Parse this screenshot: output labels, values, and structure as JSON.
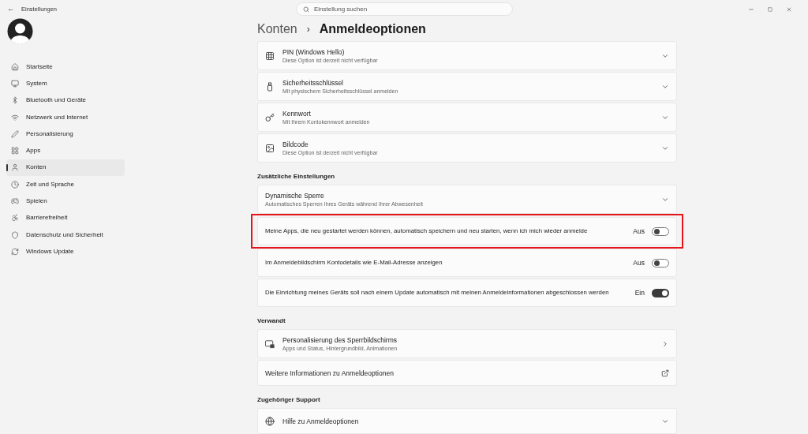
{
  "window": {
    "title": "Einstellungen",
    "back": "←"
  },
  "search": {
    "placeholder": "Einstellung suchen"
  },
  "sidebar": {
    "items": [
      {
        "label": "Startseite",
        "selected": false
      },
      {
        "label": "System",
        "selected": false
      },
      {
        "label": "Bluetooth und Geräte",
        "selected": false
      },
      {
        "label": "Netzwerk und Internet",
        "selected": false
      },
      {
        "label": "Personalisierung",
        "selected": false
      },
      {
        "label": "Apps",
        "selected": false
      },
      {
        "label": "Konten",
        "selected": true
      },
      {
        "label": "Zeit und Sprache",
        "selected": false
      },
      {
        "label": "Spielen",
        "selected": false
      },
      {
        "label": "Barrierefreiheit",
        "selected": false
      },
      {
        "label": "Datenschutz und Sicherheit",
        "selected": false
      },
      {
        "label": "Windows Update",
        "selected": false
      }
    ]
  },
  "breadcrumb": {
    "parent": "Konten",
    "separator": "›",
    "current": "Anmeldeoptionen"
  },
  "sections": [
    {
      "items": [
        {
          "kind": "expander",
          "title": "PIN (Windows Hello)",
          "subtitle": "Diese Option ist derzeit nicht verfügbar"
        },
        {
          "kind": "expander",
          "title": "Sicherheitsschlüssel",
          "subtitle": "Mit physischem Sicherheitsschlüssel anmelden"
        },
        {
          "kind": "expander",
          "title": "Kennwort",
          "subtitle": "Mit Ihrem Kontokennwort anmelden"
        },
        {
          "kind": "expander",
          "title": "Bildcode",
          "subtitle": "Diese Option ist derzeit nicht verfügbar"
        }
      ]
    },
    {
      "heading": "Zusätzliche Einstellungen",
      "items": [
        {
          "kind": "expander",
          "title": "Dynamische Sperre",
          "subtitle": "Automatisches Sperren Ihres Geräts während Ihrer Abwesenheit"
        },
        {
          "kind": "toggle",
          "title": "Meine Apps, die neu gestartet werden können, automatisch speichern und neu starten, wenn ich mich wieder anmelde",
          "state_label": "Aus",
          "on": false,
          "highlighted": true
        },
        {
          "kind": "toggle",
          "title": "Im Anmeldebildschirm Kontodetails wie E-Mail-Adresse anzeigen",
          "state_label": "Aus",
          "on": false,
          "highlighted": false
        },
        {
          "kind": "toggle",
          "title": "Die Einrichtung meines Geräts soll nach einem Update automatisch mit meinen Anmeldeinformationen abgeschlossen werden",
          "state_label": "Ein",
          "on": true,
          "highlighted": false
        }
      ]
    },
    {
      "heading": "Verwandt",
      "items": [
        {
          "kind": "link",
          "title": "Personalisierung des Sperrbildschirms",
          "subtitle": "Apps und Status, Hintergrundbild, Animationen"
        },
        {
          "kind": "external",
          "title": "Weitere Informationen zu Anmeldeoptionen"
        }
      ]
    },
    {
      "heading": "Zugehöriger Support",
      "items": [
        {
          "kind": "expander",
          "title": "Hilfe zu Anmeldeoptionen"
        }
      ]
    }
  ]
}
